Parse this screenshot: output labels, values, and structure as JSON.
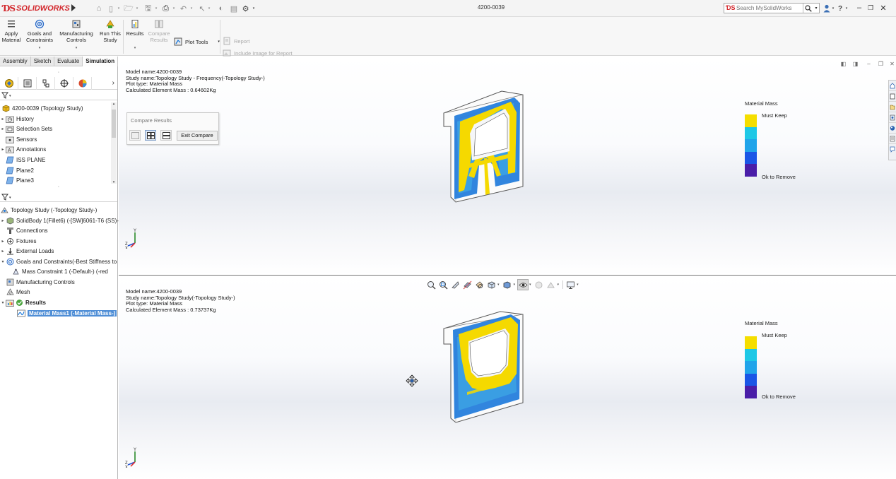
{
  "titlebar": {
    "brand": "SOLIDWORKS",
    "document_title": "4200-0039",
    "search_placeholder": "Search MySolidWorks"
  },
  "commands": {
    "apply_material": "Apply Material",
    "goals_and_constraints": "Goals and Constraints",
    "manufacturing_controls": "Manufacturing Controls",
    "run_this_study": "Run This Study",
    "results": "Results",
    "compare_results": "Compare Results",
    "plot_tools": "Plot Tools",
    "report": "Report",
    "include_image_for_report": "Include Image for Report"
  },
  "tabs": [
    "Assembly",
    "Sketch",
    "Evaluate",
    "Simulation"
  ],
  "active_tab": "Simulation",
  "tree_top": [
    {
      "label": "4200-0039  (Topology Study)",
      "icon": "part-icon"
    },
    {
      "label": "History",
      "icon": "history-folder-icon"
    },
    {
      "label": "Selection Sets",
      "icon": "selection-sets-icon"
    },
    {
      "label": "Sensors",
      "icon": "sensors-folder-icon"
    },
    {
      "label": "Annotations",
      "icon": "annotations-folder-icon"
    },
    {
      "label": "ISS PLANE",
      "icon": "plane-icon"
    },
    {
      "label": "Plane2",
      "icon": "plane-icon"
    },
    {
      "label": "Plane3",
      "icon": "plane-icon"
    }
  ],
  "tree_study": [
    {
      "label": "Topology Study (-Topology Study-)",
      "icon": "topology-study-icon"
    },
    {
      "label": "SolidBody 1(Fillet6) (-[SW]6061-T6 (SS)-",
      "icon": "solid-body-icon"
    },
    {
      "label": "Connections",
      "icon": "connections-icon"
    },
    {
      "label": "Fixtures",
      "icon": "fixtures-icon"
    },
    {
      "label": "External Loads",
      "icon": "external-loads-icon"
    },
    {
      "label": "Goals and Constraints(-Best Stiffness to",
      "icon": "goals-icon"
    },
    {
      "label": "Mass Constraint 1 (-Default-)  (-red",
      "icon": "mass-constraint-icon"
    },
    {
      "label": "Manufacturing Controls",
      "icon": "manufacturing-icon"
    },
    {
      "label": "Mesh",
      "icon": "mesh-icon"
    },
    {
      "label": "Results",
      "icon": "results-folder-icon"
    },
    {
      "label": "Material Mass1 (-Material Mass-)",
      "icon": "material-mass-plot-icon"
    }
  ],
  "viewport_top": {
    "info": [
      "Model name:4200-0039",
      "Study name:Topology Study - Frequency(-Topology Study-)",
      "Plot type: Material Mass",
      "Calculated Element Mass :  0.64602Kg"
    ]
  },
  "viewport_bottom": {
    "info": [
      "Model name:4200-0039",
      "Study name:Topology Study(-Topology Study-)",
      "Plot type: Material Mass",
      "Calculated Element Mass :  0.73737Kg"
    ]
  },
  "legend": {
    "title": "Material Mass",
    "top_label": "Must Keep",
    "bottom_label": "Ok to Remove",
    "colors": [
      "#f5de00",
      "#1ec8e6",
      "#20a4ea",
      "#1a56e6",
      "#4a1ea8"
    ]
  },
  "compare_dialog": {
    "title": "Compare Results",
    "exit_label": "Exit Compare"
  },
  "axes": {
    "y": "Y",
    "z": "Z",
    "x": "X"
  },
  "colors": {
    "yellow": "#f5d900",
    "blue": "#1f7bdb",
    "cyan": "#38b8e8",
    "brand_red": "#d3272c",
    "selection": "#4f8ed6"
  }
}
